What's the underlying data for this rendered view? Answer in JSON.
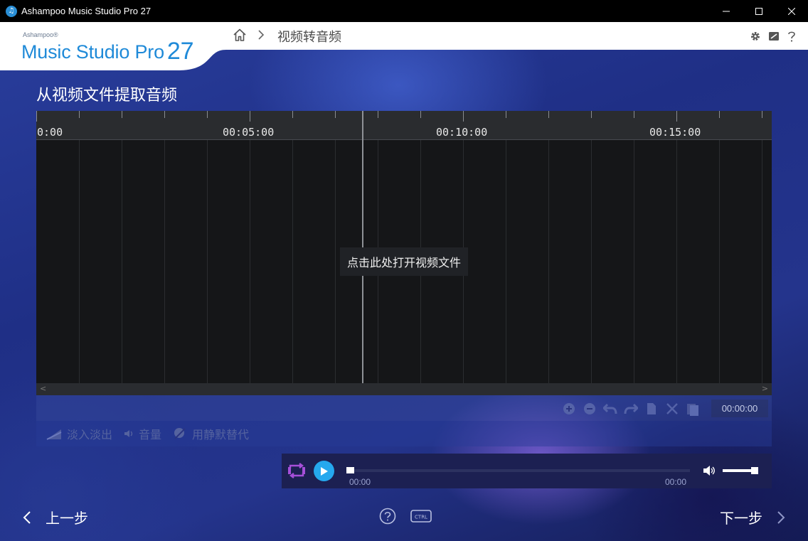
{
  "window": {
    "title": "Ashampoo Music Studio Pro 27"
  },
  "logo": {
    "brand": "Ashampoo®",
    "product": "Music Studio Pro",
    "version": "27"
  },
  "breadcrumb": {
    "current": "视频转音频"
  },
  "page": {
    "title": "从视频文件提取音频"
  },
  "timeline": {
    "tick_labels": [
      "0:00",
      "00:05:00",
      "00:10:00",
      "00:15:00"
    ],
    "open_file_label": "点击此处打开视频文件"
  },
  "edit_toolbar": {
    "time_display": "00:00:00",
    "icons": [
      "zoom-in-icon",
      "zoom-out-icon",
      "undo-icon",
      "redo-icon",
      "copy-icon",
      "cut-icon",
      "paste-icon"
    ]
  },
  "effects": {
    "fade_label": "淡入淡出",
    "volume_label": "音量",
    "silence_label": "用静默替代"
  },
  "player": {
    "time_current": "00:00",
    "time_total": "00:00",
    "progress": 0,
    "volume": 0.85
  },
  "footer": {
    "prev_label": "上一步",
    "next_label": "下一步",
    "ctrl_label": "CTRL"
  },
  "colors": {
    "accent": "#1f8ad8",
    "play_button": "#25a8ee",
    "loop_icon": "#a54fd8"
  }
}
